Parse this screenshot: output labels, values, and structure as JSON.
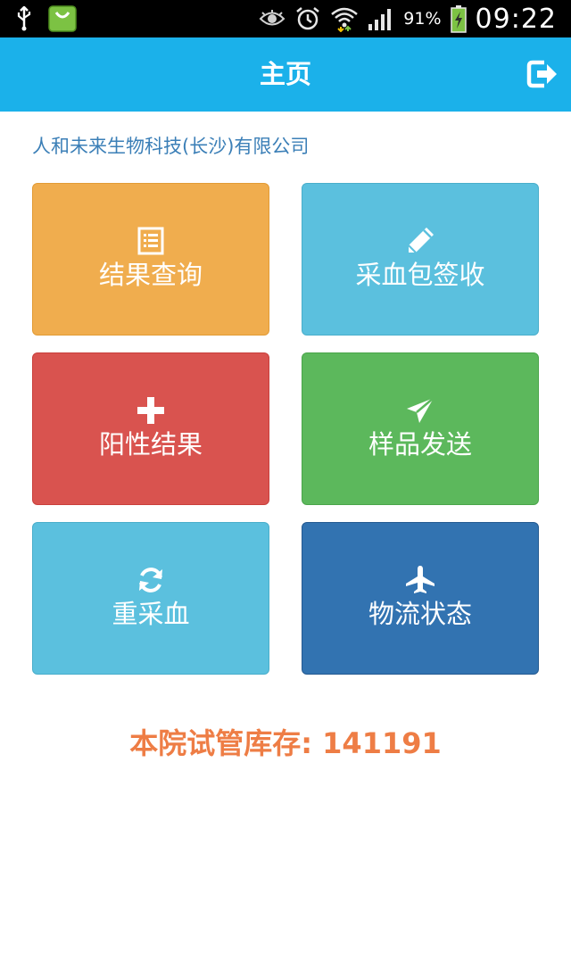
{
  "status_bar": {
    "battery_percent": "91%",
    "time": "09:22"
  },
  "header": {
    "title": "主页"
  },
  "company": "人和未来生物科技(长沙)有限公司",
  "tiles": [
    {
      "label": "结果查询",
      "icon": "list-icon",
      "color": "#f0ad4e"
    },
    {
      "label": "采血包签收",
      "icon": "pencil-icon",
      "color": "#5bc0de"
    },
    {
      "label": "阳性结果",
      "icon": "plus-icon",
      "color": "#d9534f"
    },
    {
      "label": "样品发送",
      "icon": "send-icon",
      "color": "#5cb85c"
    },
    {
      "label": "重采血",
      "icon": "refresh-icon",
      "color": "#5bc0de"
    },
    {
      "label": "物流状态",
      "icon": "plane-icon",
      "color": "#3273b1"
    }
  ],
  "inventory": {
    "label": "本院试管库存: 141191"
  },
  "colors": {
    "app_bar": "#1bb1ea",
    "company_text": "#3b7fb7",
    "inventory_text": "#ee7d45"
  }
}
